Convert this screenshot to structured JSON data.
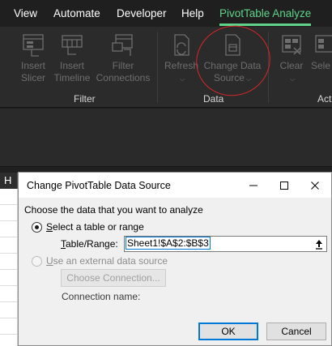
{
  "ribbon": {
    "tabs": [
      {
        "label": "View",
        "active": false
      },
      {
        "label": "Automate",
        "active": false
      },
      {
        "label": "Developer",
        "active": false
      },
      {
        "label": "Help",
        "active": false
      },
      {
        "label": "PivotTable Analyze",
        "active": true
      }
    ],
    "filter_group": {
      "label": "Filter",
      "buttons": [
        "Insert\nSlicer",
        "Insert\nTimeline",
        "Filter\nConnections"
      ]
    },
    "data_group": {
      "label": "Data",
      "refresh": "Refresh",
      "change_source_line1": "Change Data",
      "change_source_line2": "Source"
    },
    "actions_group": {
      "label": "Act",
      "clear": "Clear",
      "select": "Sele"
    },
    "accent_color": "#5fd38a"
  },
  "sheet": {
    "column_header": "H"
  },
  "dialog": {
    "title": "Change PivotTable Data Source",
    "prompt": "Choose the data that you want to analyze",
    "option_table": {
      "label_prefix": "",
      "label_underlined": "S",
      "label_rest": "elect a table or range",
      "selected": true
    },
    "range_label_underlined": "T",
    "range_label_rest": "able/Range:",
    "range_value": "Sheet1!$A$2:$B$3",
    "option_external": {
      "label_underlined": "U",
      "label_rest": "se an external data source",
      "selected": false
    },
    "choose_connection_label": "Choose Connection...",
    "connection_name_label": "Connection name:",
    "ok_label": "OK",
    "cancel_label": "Cancel"
  }
}
